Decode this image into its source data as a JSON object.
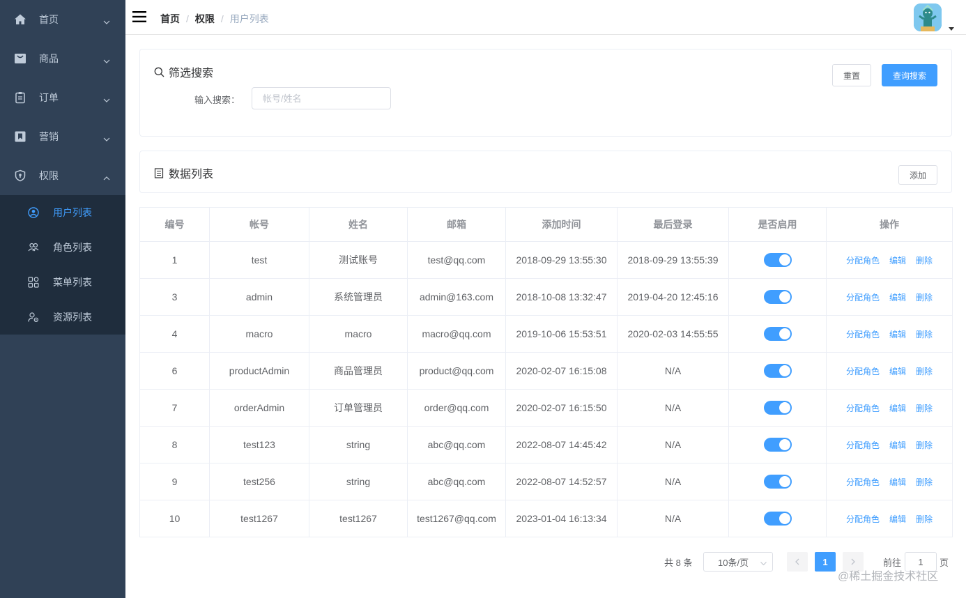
{
  "sidebar": {
    "items": [
      {
        "label": "首页",
        "icon": "home-icon"
      },
      {
        "label": "商品",
        "icon": "shopping-bag-icon"
      },
      {
        "label": "订单",
        "icon": "clipboard-icon"
      },
      {
        "label": "营销",
        "icon": "bookmark-icon"
      },
      {
        "label": "权限",
        "icon": "shield-icon"
      }
    ],
    "subitems": [
      {
        "label": "用户列表",
        "icon": "user-circle-icon",
        "active": true
      },
      {
        "label": "角色列表",
        "icon": "users-icon"
      },
      {
        "label": "菜单列表",
        "icon": "grid-icon"
      },
      {
        "label": "资源列表",
        "icon": "user-settings-icon"
      }
    ],
    "colors": {
      "bg": "#304156",
      "sub_bg": "#1f2d3d",
      "text": "#bfcbd9",
      "active": "#409eff"
    }
  },
  "navbar": {
    "breadcrumb": [
      "首页",
      "权限",
      "用户列表"
    ],
    "separator": "/"
  },
  "filter": {
    "title": "筛选搜索",
    "reset_label": "重置",
    "search_label": "查询搜索",
    "input_label": "输入搜索：",
    "input_placeholder": "帐号/姓名",
    "input_value": ""
  },
  "list": {
    "title": "数据列表",
    "add_label": "添加"
  },
  "table": {
    "headers": [
      "编号",
      "帐号",
      "姓名",
      "邮箱",
      "添加时间",
      "最后登录",
      "是否启用",
      "操作"
    ],
    "rows": [
      {
        "id": "1",
        "account": "test",
        "name": "测试账号",
        "email": "test@qq.com",
        "created": "2018-09-29 13:55:30",
        "last_login": "2018-09-29 13:55:39",
        "enabled": true
      },
      {
        "id": "3",
        "account": "admin",
        "name": "系统管理员",
        "email": "admin@163.com",
        "created": "2018-10-08 13:32:47",
        "last_login": "2019-04-20 12:45:16",
        "enabled": true
      },
      {
        "id": "4",
        "account": "macro",
        "name": "macro",
        "email": "macro@qq.com",
        "created": "2019-10-06 15:53:51",
        "last_login": "2020-02-03 14:55:55",
        "enabled": true
      },
      {
        "id": "6",
        "account": "productAdmin",
        "name": "商品管理员",
        "email": "product@qq.com",
        "created": "2020-02-07 16:15:08",
        "last_login": "N/A",
        "enabled": true
      },
      {
        "id": "7",
        "account": "orderAdmin",
        "name": "订单管理员",
        "email": "order@qq.com",
        "created": "2020-02-07 16:15:50",
        "last_login": "N/A",
        "enabled": true
      },
      {
        "id": "8",
        "account": "test123",
        "name": "string",
        "email": "abc@qq.com",
        "created": "2022-08-07 14:45:42",
        "last_login": "N/A",
        "enabled": true
      },
      {
        "id": "9",
        "account": "test256",
        "name": "string",
        "email": "abc@qq.com",
        "created": "2022-08-07 14:52:57",
        "last_login": "N/A",
        "enabled": true
      },
      {
        "id": "10",
        "account": "test1267",
        "name": "test1267",
        "email": "test1267@qq.com",
        "created": "2023-01-04 16:13:34",
        "last_login": "N/A",
        "enabled": true
      }
    ],
    "actions": [
      "分配角色",
      "编辑",
      "删除"
    ]
  },
  "pagination": {
    "total": "共 8 条",
    "page_size": "10条/页",
    "current_page": "1",
    "goto_prefix": "前往",
    "goto_value": "1",
    "goto_suffix": "页"
  },
  "watermark": "@稀土掘金技术社区",
  "colors": {
    "primary": "#409eff",
    "border": "#ebeef5",
    "header_text": "#909399"
  }
}
